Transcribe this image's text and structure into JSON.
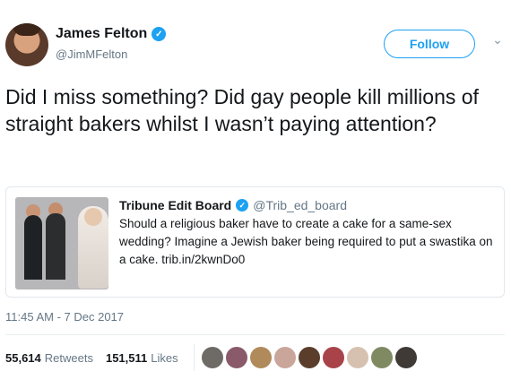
{
  "tweet": {
    "author_name": "James Felton",
    "author_handle": "@JimMFelton",
    "verified_icon": "verified-badge-icon",
    "follow_label": "Follow",
    "text": "Did I miss something? Did gay people kill millions of straight bakers whilst I wasn’t paying attention?",
    "timestamp": "11:45 AM - 7 Dec 2017",
    "retweets_count": "55,614",
    "retweets_label": "Retweets",
    "likes_count": "151,511",
    "likes_label": "Likes"
  },
  "quote": {
    "author_name": "Tribune Edit Board",
    "author_handle": "@Trib_ed_board",
    "text": "Should a religious baker have to create a cake for a same-sex wedding? Imagine a Jewish baker being required to put a swastika on a cake. trib.in/2kwnDo0"
  },
  "liker_avatars": [
    {
      "color": "#6e6a66"
    },
    {
      "color": "#8a5a6a"
    },
    {
      "color": "#b08a5a"
    },
    {
      "color": "#c9a59a"
    },
    {
      "color": "#5a3d2b"
    },
    {
      "color": "#a8434a"
    },
    {
      "color": "#d6c1b0"
    },
    {
      "color": "#7f8a63"
    },
    {
      "color": "#3f3a36"
    }
  ],
  "colors": {
    "accent": "#1da1f2",
    "text": "#14171a",
    "muted": "#657786"
  }
}
